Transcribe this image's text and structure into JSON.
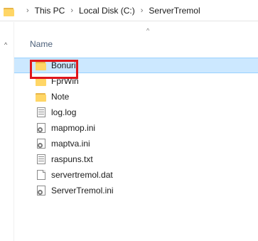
{
  "address_bar": {
    "folder_icon": "folder-icon",
    "separator": "›",
    "crumbs": [
      "This PC",
      "Local Disk (C:)",
      "ServerTremol"
    ]
  },
  "nav_pane": {
    "collapse_caret": "^"
  },
  "column_header": {
    "name_label": "Name",
    "sort_caret": "^"
  },
  "files": [
    {
      "name": "Bonuri",
      "icon": "folder-icon",
      "selected": true
    },
    {
      "name": "FprWin",
      "icon": "folder-icon"
    },
    {
      "name": "Note",
      "icon": "folder-icon"
    },
    {
      "name": "log.log",
      "icon": "text-file-icon"
    },
    {
      "name": "mapmop.ini",
      "icon": "settings-file-icon"
    },
    {
      "name": "maptva.ini",
      "icon": "settings-file-icon"
    },
    {
      "name": "raspuns.txt",
      "icon": "text-file-icon"
    },
    {
      "name": "servertremol.dat",
      "icon": "blank-file-icon"
    },
    {
      "name": "ServerTremol.ini",
      "icon": "settings-file-icon"
    }
  ],
  "colors": {
    "selection_bg": "#cce8ff",
    "highlight_border": "#e0161c",
    "folder": "#ffd666"
  }
}
